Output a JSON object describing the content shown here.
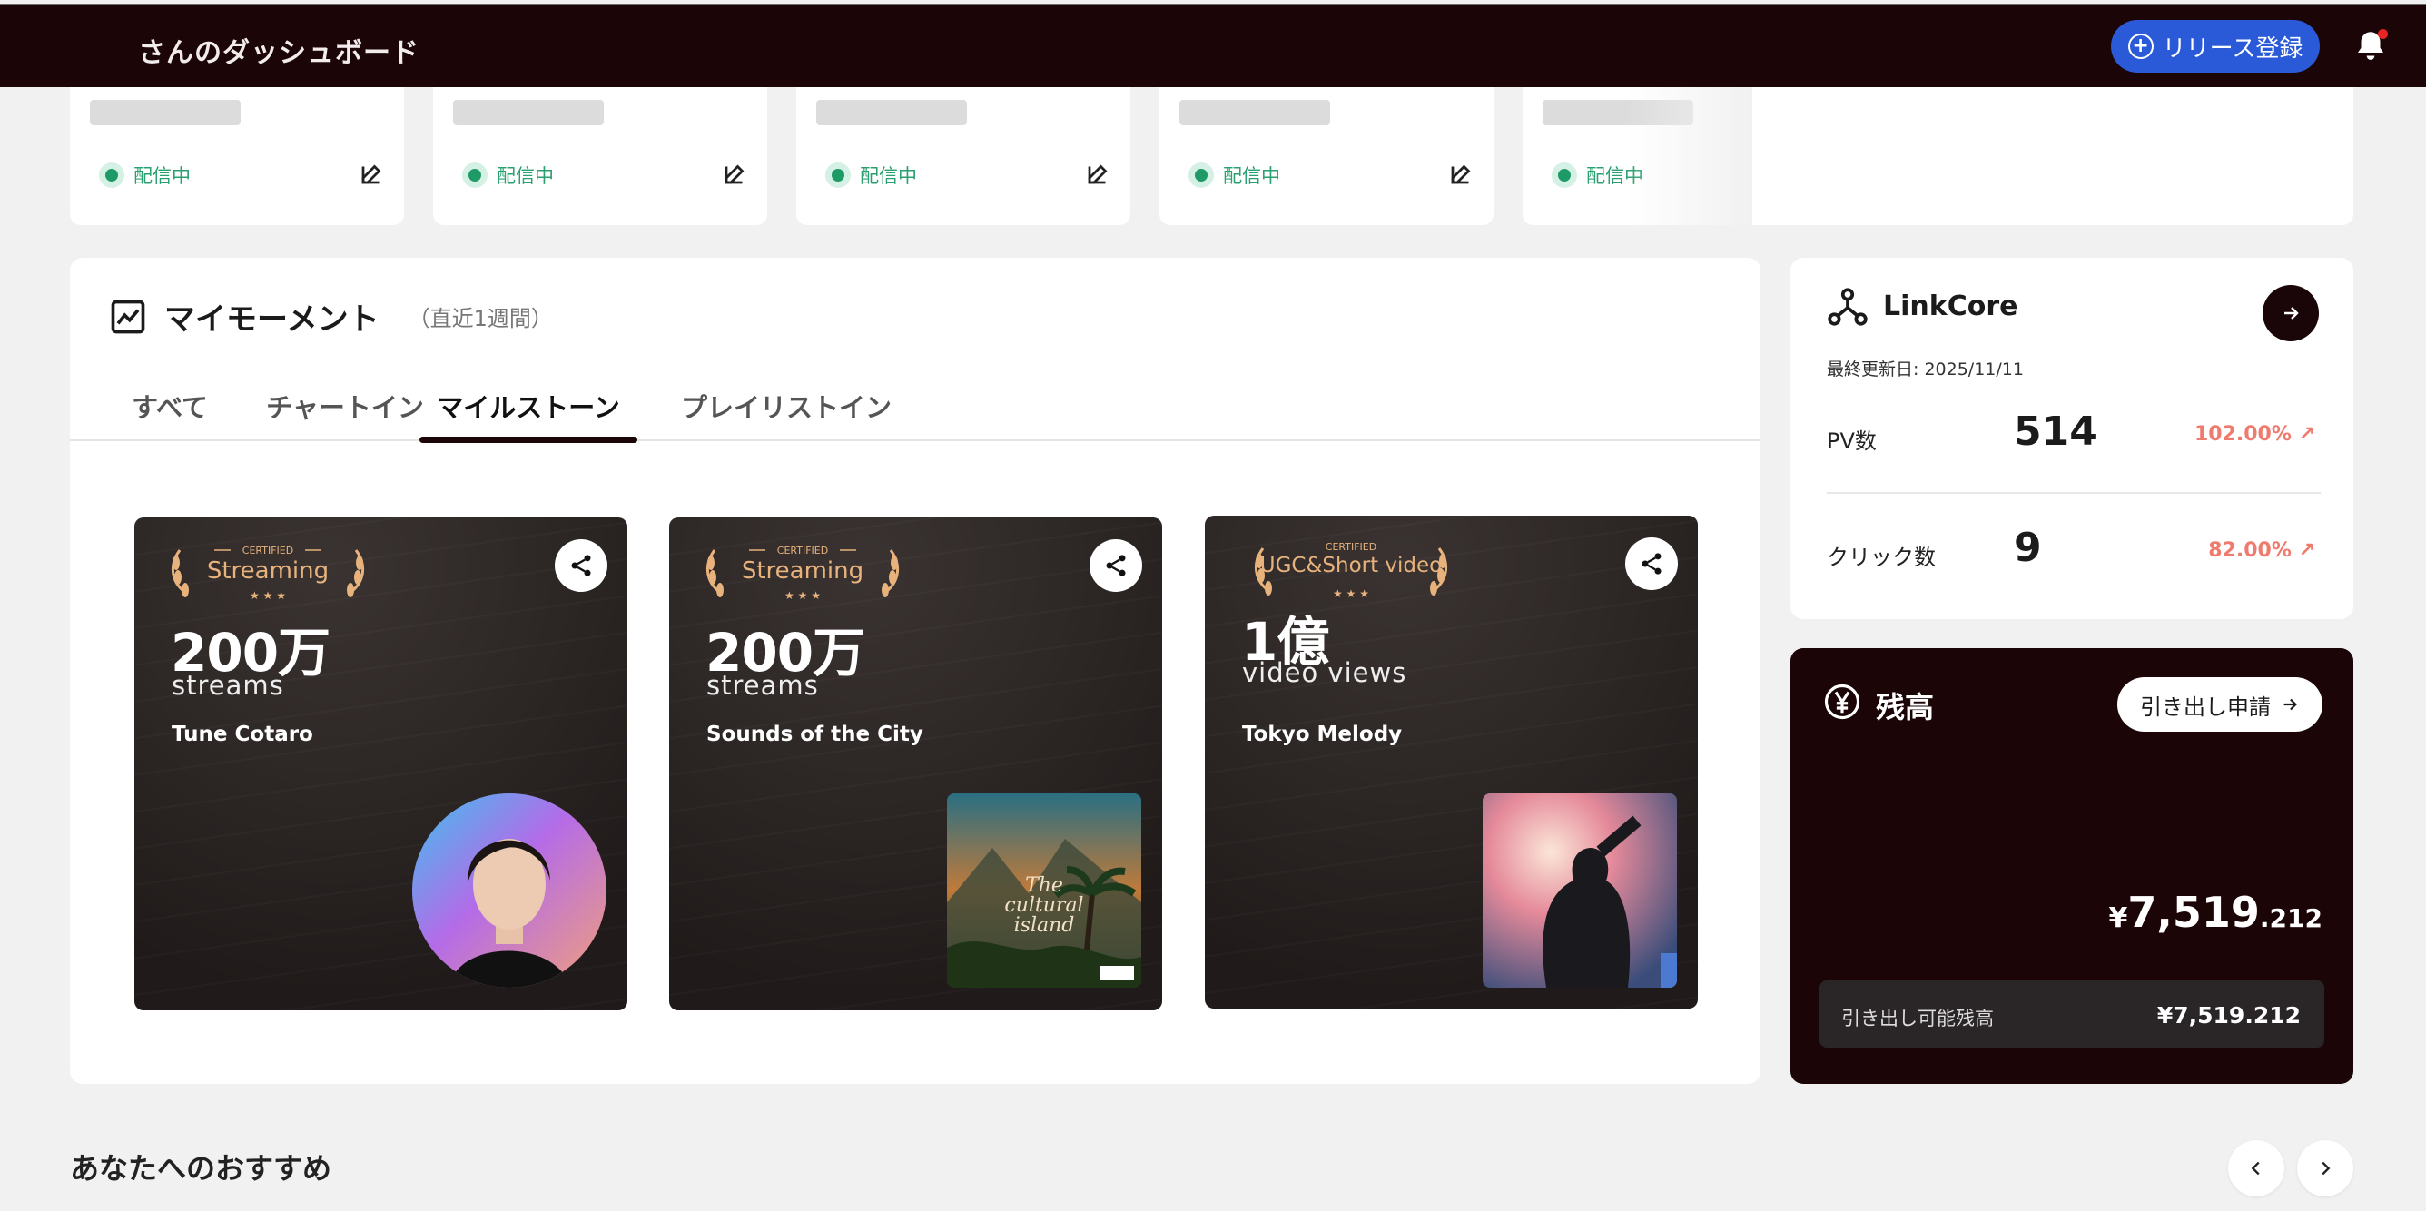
{
  "header": {
    "title": "さんのダッシュボード",
    "release_button": "リリース登録",
    "notification_dot_color": "#e82424"
  },
  "releases": [
    {
      "status": "配信中"
    },
    {
      "status": "配信中"
    },
    {
      "status": "配信中"
    },
    {
      "status": "配信中"
    },
    {
      "status": "配信中"
    }
  ],
  "moment": {
    "title": "マイモーメント",
    "subtitle": "（直近1週間）",
    "tabs": [
      {
        "label": "すべて",
        "active": false
      },
      {
        "label": "チャートイン",
        "active": false
      },
      {
        "label": "マイルストーン",
        "active": true
      },
      {
        "label": "プレイリストイン",
        "active": false
      }
    ],
    "cards": [
      {
        "badge_top": "CERTIFIED",
        "badge_main": "Streaming",
        "big": "200万",
        "unit": "streams",
        "artist": "Tune Cotaro",
        "image": "artist-portrait"
      },
      {
        "badge_top": "CERTIFIED",
        "badge_main": "Streaming",
        "big": "200万",
        "unit": "streams",
        "artist": "Sounds of the City",
        "image": "album-cover"
      },
      {
        "badge_top": "CERTIFIED",
        "badge_main": "UGC&Short video",
        "big": "1億",
        "unit": "video views",
        "artist": "Tokyo Melody",
        "image": "concert-photo"
      }
    ]
  },
  "linkcore": {
    "title": "LinkCore",
    "updated": "最終更新日: 2025/11/11",
    "rows": [
      {
        "label": "PV数",
        "value": "514",
        "pct": "102.00%"
      },
      {
        "label": "クリック数",
        "value": "9",
        "pct": "82.00%"
      }
    ],
    "accent_color": "#ef7a6e"
  },
  "balance": {
    "title": "残高",
    "withdraw_button": "引き出し申請",
    "amount_yen": "¥",
    "amount_main": "7,519",
    "amount_dec": ".212",
    "available_label": "引き出し可能残高",
    "available_value": "¥7,519.212"
  },
  "recommend": {
    "title": "あなたへのおすすめ"
  }
}
